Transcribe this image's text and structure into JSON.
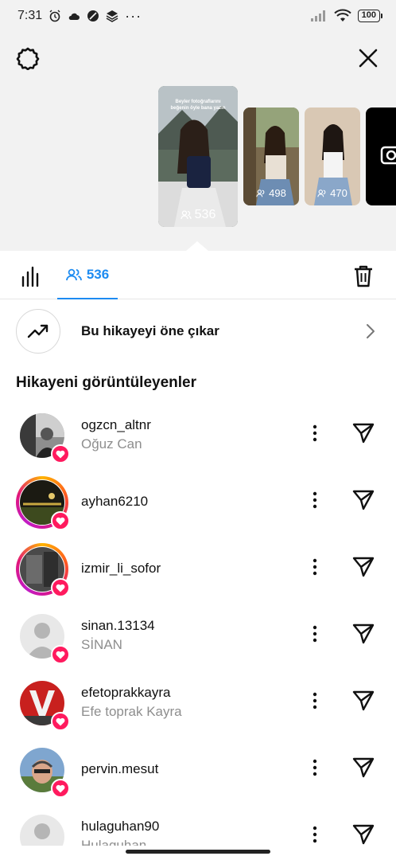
{
  "status_bar": {
    "time": "7:31",
    "dots": "···",
    "battery": "100"
  },
  "preview": {
    "main_caption": "Beyler fotoğraflarını beğenin öyle bana yazın",
    "main_count": "536",
    "second_count": "498",
    "third_count": "470"
  },
  "tabs": {
    "viewers_count": "536"
  },
  "promote": {
    "label": "Bu hikayeyi öne çıkar"
  },
  "section": {
    "title": "Hikayeni görüntüleyenler"
  },
  "viewers": [
    {
      "username": "ogzcn_altnr",
      "fullname": "Oğuz Can"
    },
    {
      "username": "ayhan6210",
      "fullname": ""
    },
    {
      "username": "izmir_li_sofor",
      "fullname": ""
    },
    {
      "username": "sinan.13134",
      "fullname": "SİNAN"
    },
    {
      "username": "efetoprakkayra",
      "fullname": "Efe toprak Kayra"
    },
    {
      "username": "pervin.mesut",
      "fullname": ""
    },
    {
      "username": "hulaguhan90",
      "fullname": "Hulaguhan"
    }
  ],
  "colors": {
    "accent": "#1d8bf1",
    "like": "#ff1a5e",
    "muted": "#8e8e8e"
  }
}
